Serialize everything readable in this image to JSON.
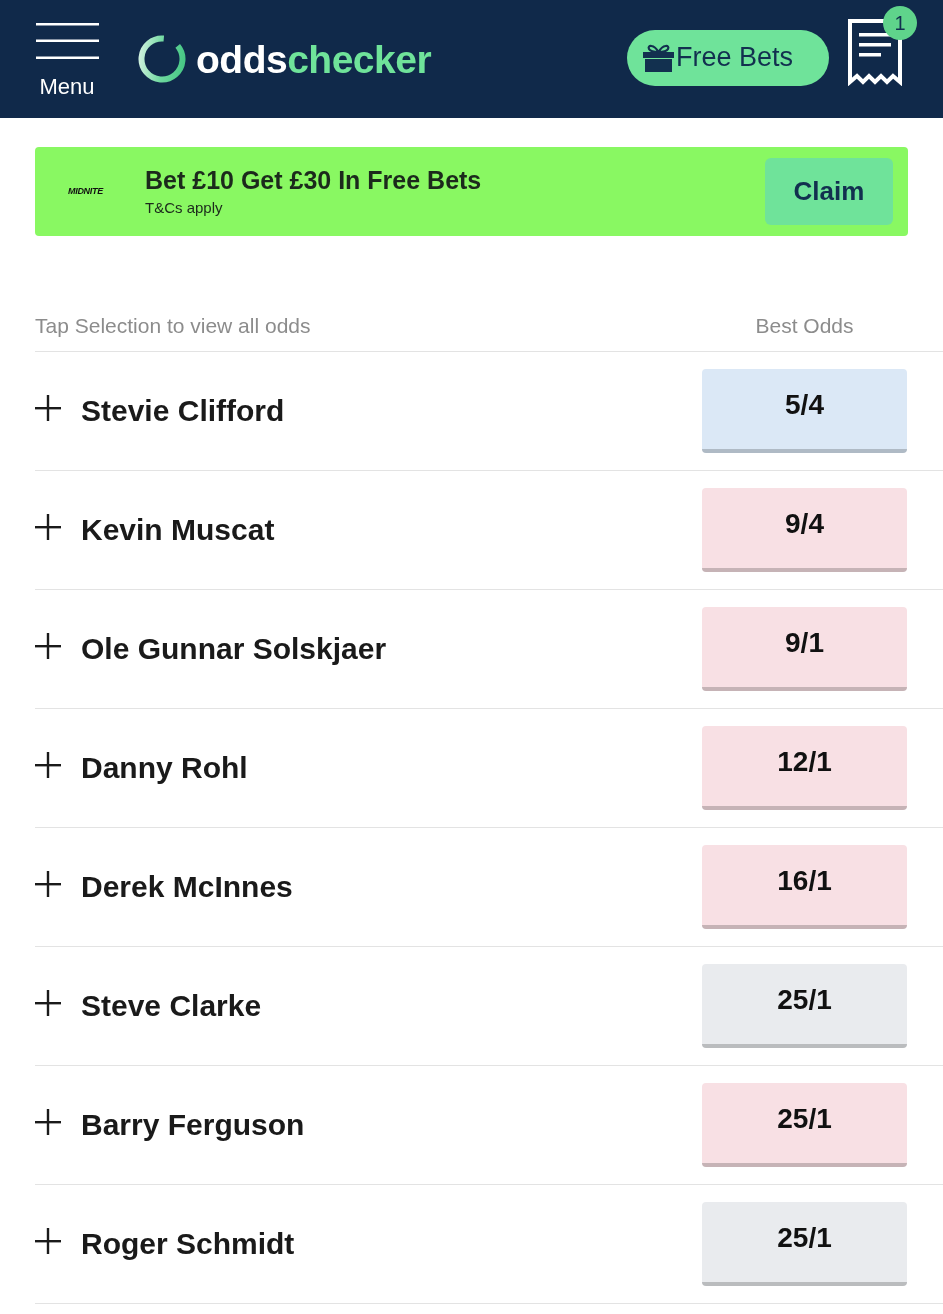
{
  "header": {
    "menu_label": "Menu",
    "logo_text": [
      "odds",
      "checker"
    ],
    "free_bets_button": "Free Bets",
    "betslip_count": "1"
  },
  "promo": {
    "brand": "MIDNITE",
    "title": "Bet £10 Get £30 In Free Bets",
    "subtitle": "T&Cs apply",
    "button": "Claim"
  },
  "table": {
    "columns": [
      "Tap Selection to view all odds",
      "Best Odds"
    ],
    "rows": [
      {
        "name": "Stevie Clifford",
        "odds": "5/4",
        "color": "#dbe8f6"
      },
      {
        "name": "Kevin Muscat",
        "odds": "9/4",
        "color": "#f8e0e4"
      },
      {
        "name": "Ole Gunnar Solskjaer",
        "odds": "9/1",
        "color": "#f8e0e4"
      },
      {
        "name": "Danny Rohl",
        "odds": "12/1",
        "color": "#f8e0e4"
      },
      {
        "name": "Derek McInnes",
        "odds": "16/1",
        "color": "#f8e0e4"
      },
      {
        "name": "Steve Clarke",
        "odds": "25/1",
        "color": "#e9ebee"
      },
      {
        "name": "Barry Ferguson",
        "odds": "25/1",
        "color": "#f8e0e4"
      },
      {
        "name": "Roger Schmidt",
        "odds": "25/1",
        "color": "#e9ebee"
      }
    ]
  }
}
